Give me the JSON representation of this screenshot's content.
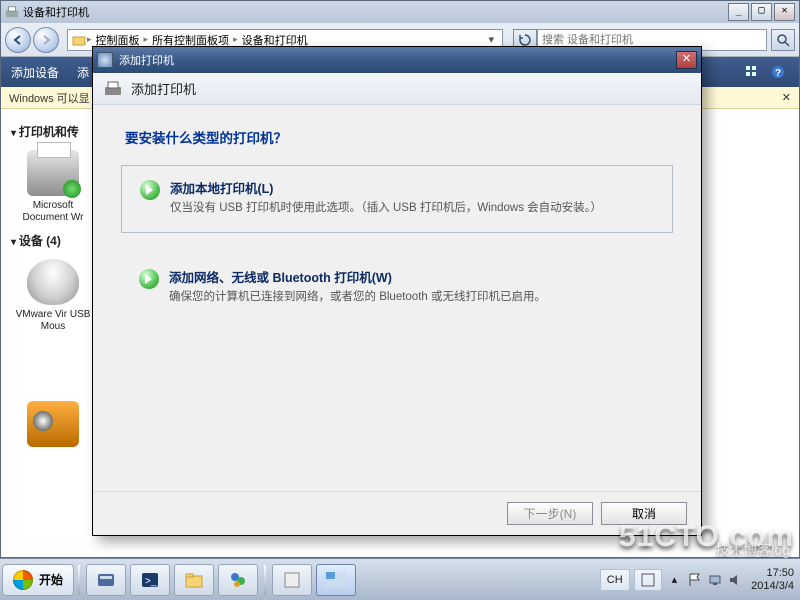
{
  "explorer": {
    "title": "设备和打印机",
    "breadcrumb": [
      "控制面板",
      "所有控制面板项",
      "设备和打印机"
    ],
    "search_placeholder": "搜索 设备和打印机",
    "cmd_add_device": "添加设备",
    "cmd_add_printer": "添",
    "info_strip": "Windows 可以显",
    "cat_printers": "打印机和传",
    "dev_ms_xps": "Microsoft Document Wr",
    "cat_devices": "设备 (4)",
    "dev_mouse": "VMware Vir USB Mous"
  },
  "wizard": {
    "title": "添加打印机",
    "header": "添加打印机",
    "question": "要安装什么类型的打印机？",
    "opt1_title": "添加本地打印机(L)",
    "opt1_desc": "仅当没有 USB 打印机时使用此选项。（插入 USB 打印机后，Windows 会自动安装。）",
    "opt2_title": "添加网络、无线或 Bluetooth 打印机(W)",
    "opt2_desc": "确保您的计算机已连接到网络，或者您的 Bluetooth 或无线打印机已启用。",
    "btn_next": "下一步(N)",
    "btn_cancel": "取消"
  },
  "taskbar": {
    "start": "开始",
    "lang": "CH",
    "time": "17:50",
    "date": "2014/3/4"
  },
  "watermark": "51CTO.com",
  "watermark2": "技术博客log"
}
